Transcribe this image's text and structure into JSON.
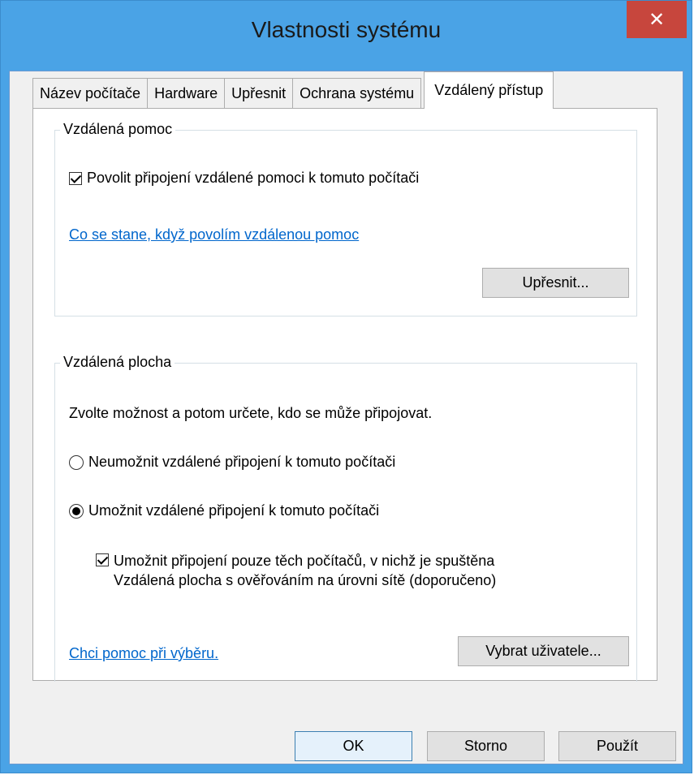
{
  "window": {
    "title": "Vlastnosti systému",
    "close_glyph": "✕"
  },
  "tabs": [
    {
      "label": "Název počítače"
    },
    {
      "label": "Hardware"
    },
    {
      "label": "Upřesnit"
    },
    {
      "label": "Ochrana systému"
    },
    {
      "label": "Vzdálený přístup",
      "active": true
    }
  ],
  "remote_assistance": {
    "legend": "Vzdálená pomoc",
    "checkbox_label": "Povolit připojení vzdálené pomoci k tomuto počítači",
    "checkbox_checked": true,
    "help_link": "Co se stane, když povolím vzdálenou pomoc",
    "advanced_button": "Upřesnit..."
  },
  "remote_desktop": {
    "legend": "Vzdálená plocha",
    "instruction": "Zvolte možnost a potom určete, kdo se může připojovat.",
    "radio_deny": "Neumožnit vzdálené připojení k tomuto počítači",
    "radio_allow": "Umožnit vzdálené připojení k tomuto počítači",
    "selected": "allow",
    "nla_line1": "Umožnit připojení pouze těch počítačů, v nichž je spuštěna",
    "nla_line2": "Vzdálená plocha s ověřováním na úrovni sítě (doporučeno)",
    "nla_checked": true,
    "help_link": "Chci pomoc při výběru.",
    "select_users_button": "Vybrat uživatele..."
  },
  "footer": {
    "ok": "OK",
    "cancel": "Storno",
    "apply": "Použít"
  },
  "colors": {
    "frame": "#4aa3e6",
    "close": "#c7463d",
    "link": "#0066cc"
  }
}
